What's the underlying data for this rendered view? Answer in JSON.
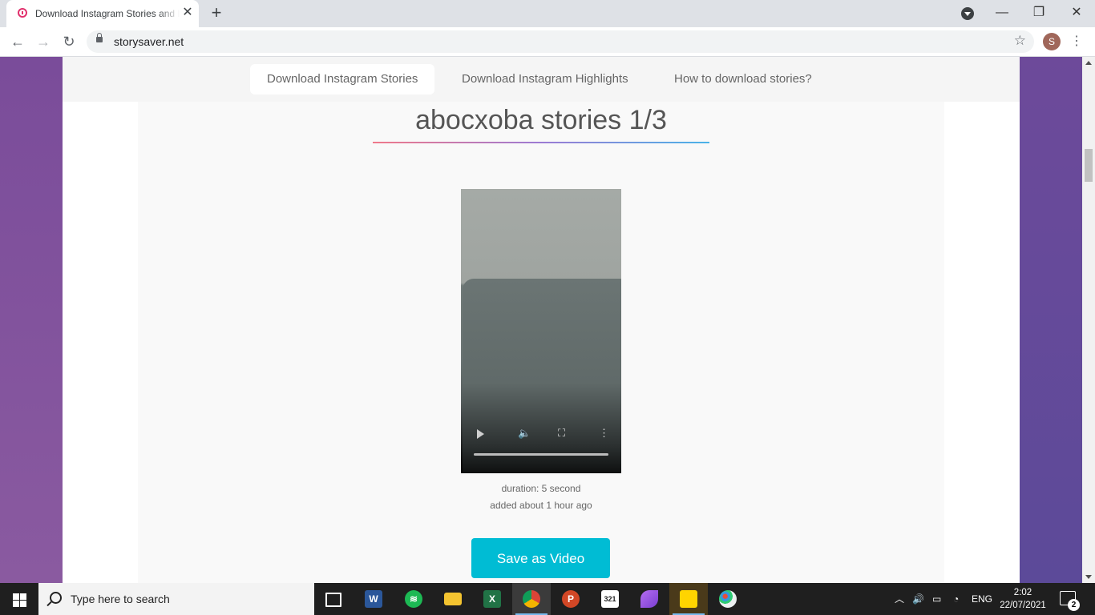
{
  "browser": {
    "tab_title": "Download Instagram Stories and Highlights",
    "tab_close": "✕",
    "new_tab": "+",
    "url": "storysaver.net",
    "avatar_letter": "S",
    "minimize": "—",
    "restore": "❐",
    "close": "✕"
  },
  "site_nav": {
    "items": [
      {
        "label": "Download Instagram Stories"
      },
      {
        "label": "Download Instagram Highlights"
      },
      {
        "label": "How to download stories?"
      }
    ],
    "active_index": 0
  },
  "story": {
    "title": "abocxoba stories 1/3",
    "duration": "duration: 5 second",
    "added": "added about 1 hour ago",
    "save_button": "Save as Video"
  },
  "taskbar": {
    "search_placeholder": "Type here to search",
    "language": "ENG",
    "time": "2:02",
    "date": "22/07/2021",
    "notification_count": "2",
    "apps": [
      "task-view",
      "word",
      "spotify",
      "file-explorer",
      "excel",
      "chrome",
      "powerpoint",
      "calendar-321",
      "feather-app",
      "sticky-notes",
      "paint"
    ]
  },
  "colors": {
    "accent": "#00bcd4",
    "page_background": "#5c4a99"
  }
}
